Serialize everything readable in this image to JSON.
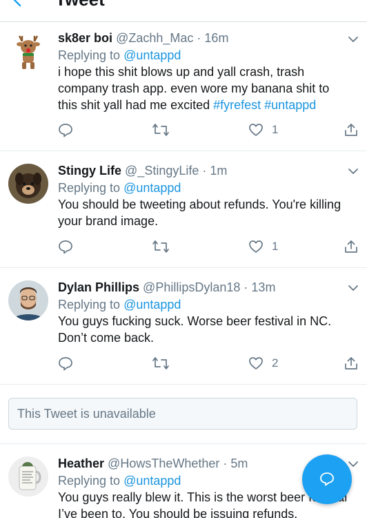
{
  "header": {
    "title": "Tweet"
  },
  "tweets": [
    {
      "name": "sk8er boi",
      "handle": "@Zachh_Mac",
      "separator": "·",
      "time": "16m",
      "reply_prefix": "Replying to ",
      "reply_mention": "@untappd",
      "text_lines": [
        "i hope this shit blows up and yall crash, trash",
        "company trash app. even wore my banana shit to",
        "this shit yall had me excited "
      ],
      "hashtags": [
        "#fyrefest",
        "#untappd"
      ],
      "likes": "1"
    },
    {
      "name": "Stingy Life",
      "handle": "@_StingyLife",
      "separator": "·",
      "time": "1m",
      "reply_prefix": "Replying to ",
      "reply_mention": "@untappd",
      "text_lines": [
        "You should be tweeting about refunds. You're killing",
        "your brand image."
      ],
      "likes": "1"
    },
    {
      "name": "Dylan Phillips",
      "handle": "@PhillipsDylan18",
      "separator": "·",
      "time": "13m",
      "reply_prefix": "Replying to ",
      "reply_mention": "@untappd",
      "text_lines": [
        "You guys fucking suck. Worse beer festival in NC.",
        "Don’t come back."
      ],
      "likes": "2"
    },
    {
      "name": "Heather",
      "handle": "@HowsTheWhether",
      "separator": "·",
      "time": "5m",
      "reply_prefix": "Replying to ",
      "reply_mention": "@untappd",
      "text_lines": [
        "You guys really blew it. This is the worst beer festival",
        "I’ve been to. You should be issuing refunds."
      ]
    }
  ],
  "unavailable": {
    "text": "This Tweet is unavailable"
  },
  "colors": {
    "accent": "#1da1f2",
    "link": "#1b95e0",
    "muted": "#657786"
  },
  "icons": [
    "back-arrow-icon",
    "chevron-down-icon",
    "reply-icon",
    "retweet-icon",
    "heart-icon",
    "share-icon",
    "compose-icon"
  ]
}
